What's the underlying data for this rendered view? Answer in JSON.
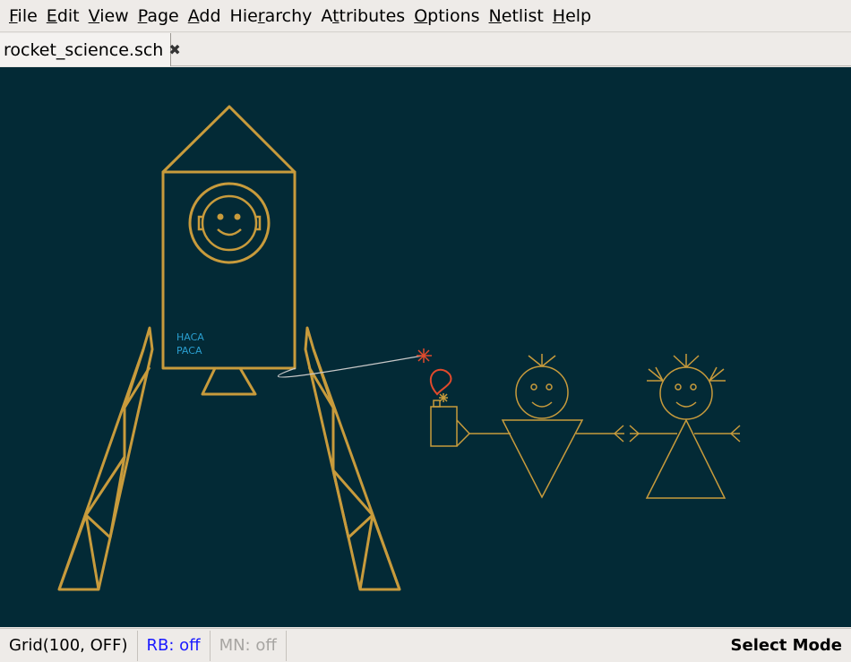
{
  "menubar": {
    "items": [
      {
        "mn": "F",
        "rest": "ile"
      },
      {
        "mn": "E",
        "rest": "dit"
      },
      {
        "mn": "V",
        "rest": "iew"
      },
      {
        "mn": "P",
        "rest": "age"
      },
      {
        "mn": "A",
        "rest": "dd"
      },
      {
        "pre": "Hie",
        "mn": "r",
        "rest": "archy"
      },
      {
        "pre": "A",
        "mn": "t",
        "rest": "tributes"
      },
      {
        "mn": "O",
        "rest": "ptions"
      },
      {
        "mn": "N",
        "rest": "etlist"
      },
      {
        "mn": "H",
        "rest": "elp"
      }
    ]
  },
  "tabs": [
    {
      "label": "rocket_science.sch",
      "close_glyph": "✖"
    }
  ],
  "canvas": {
    "background": "#032a36",
    "stroke_color": "#c89b3c",
    "accent_text_color": "#2a9fd0",
    "rocket_text": [
      "HACA",
      "PACA"
    ]
  },
  "statusbar": {
    "grid": "Grid(100, OFF)",
    "rb": "RB: off",
    "mn": "MN: off",
    "mode": "Select Mode"
  }
}
